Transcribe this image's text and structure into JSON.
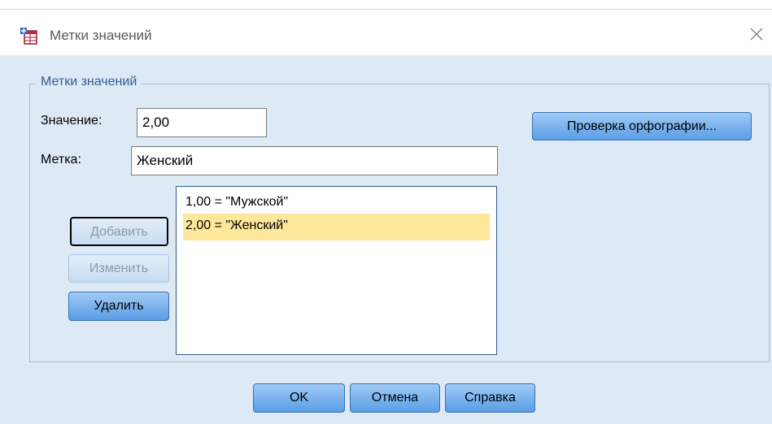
{
  "window": {
    "title": "Метки значений",
    "icon": "value-labels-app-icon",
    "close_icon": "close-icon"
  },
  "group": {
    "legend": "Метки значений"
  },
  "value_field": {
    "label": "Значение:",
    "value": "2,00"
  },
  "label_field": {
    "label": "Метка:",
    "value": "Женский"
  },
  "buttons": {
    "spelling": "Проверка орфографии...",
    "add": "Добавить",
    "change": "Изменить",
    "remove": "Удалить",
    "ok": "OK",
    "cancel": "Отмена",
    "help": "Справка"
  },
  "list": {
    "items": [
      {
        "text": "1,00 = \"Мужской\"",
        "selected": false
      },
      {
        "text": "2,00 = \"Женский\"",
        "selected": true
      }
    ]
  },
  "colors": {
    "client_background": "#dde9f5",
    "selection": "#fde79a",
    "button_gradient_top": "#9fcaf5",
    "button_gradient_bottom": "#5a9ee6",
    "legend_text": "#2e5e94"
  }
}
